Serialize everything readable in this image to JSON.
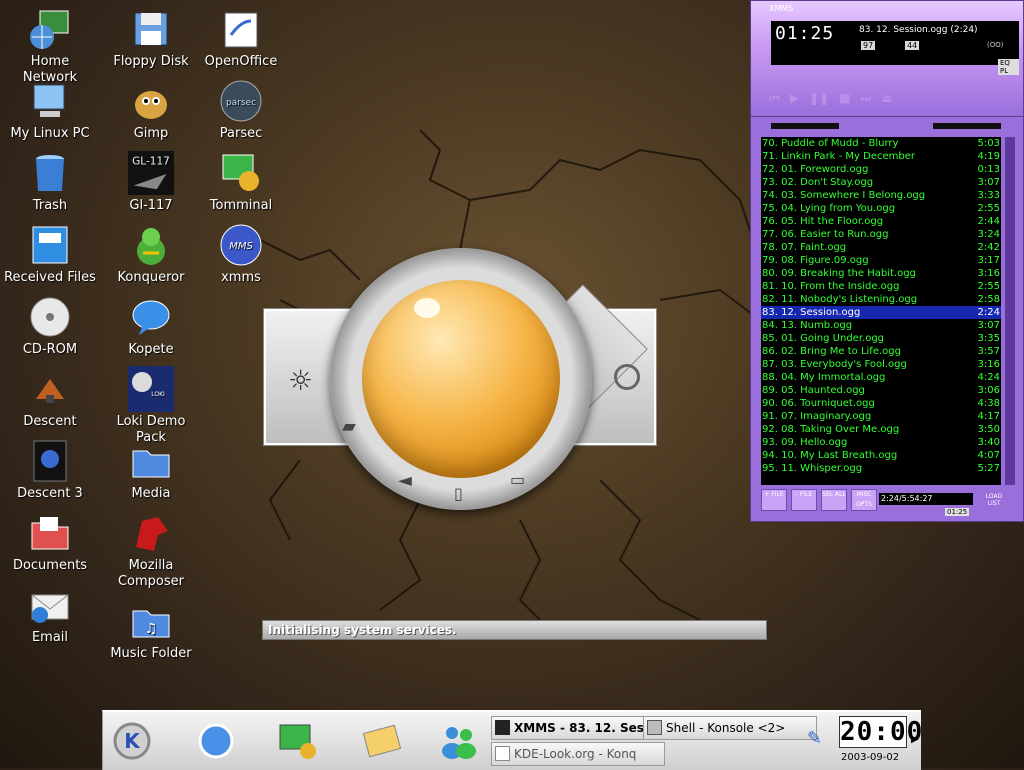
{
  "desktop": {
    "icons": [
      {
        "label": "Home Network"
      },
      {
        "label": "Floppy Disk"
      },
      {
        "label": "OpenOffice"
      },
      {
        "label": "My Linux PC"
      },
      {
        "label": "Gimp"
      },
      {
        "label": "Parsec"
      },
      {
        "label": "Trash"
      },
      {
        "label": "Gl-117"
      },
      {
        "label": "Tomminal"
      },
      {
        "label": "Received Files"
      },
      {
        "label": "Konqueror"
      },
      {
        "label": "xmms"
      },
      {
        "label": "CD-ROM"
      },
      {
        "label": "Kopete"
      },
      {
        "label": "Descent"
      },
      {
        "label": "Loki Demo Pack"
      },
      {
        "label": "Descent 3"
      },
      {
        "label": "Media"
      },
      {
        "label": "Documents"
      },
      {
        "label": "Mozilla Composer"
      },
      {
        "label": "Email"
      },
      {
        "label": "Music Folder"
      }
    ]
  },
  "splash": {
    "status_text": "Initialising system services."
  },
  "xmms": {
    "title": "XMMS",
    "time": "01:25",
    "song_title": "83. 12. Session.ogg (2:24)",
    "kbps": "97",
    "khz": "44",
    "channel": "(OO)",
    "mode_label": "EQ PL",
    "playlist": [
      {
        "title": "70. Puddle of Mudd - Blurry",
        "time": "5:03"
      },
      {
        "title": "71. Linkin Park - My December",
        "time": "4:19"
      },
      {
        "title": "72. 01. Foreword.ogg",
        "time": "0:13"
      },
      {
        "title": "73. 02. Don't Stay.ogg",
        "time": "3:07"
      },
      {
        "title": "74. 03. Somewhere I Belong.ogg",
        "time": "3:33"
      },
      {
        "title": "75. 04. Lying from You.ogg",
        "time": "2:55"
      },
      {
        "title": "76. 05. Hit the Floor.ogg",
        "time": "2:44"
      },
      {
        "title": "77. 06. Easier to Run.ogg",
        "time": "3:24"
      },
      {
        "title": "78. 07. Faint.ogg",
        "time": "2:42"
      },
      {
        "title": "79. 08. Figure.09.ogg",
        "time": "3:17"
      },
      {
        "title": "80. 09. Breaking the Habit.ogg",
        "time": "3:16"
      },
      {
        "title": "81. 10. From the Inside.ogg",
        "time": "2:55"
      },
      {
        "title": "82. 11. Nobody's Listening.ogg",
        "time": "2:58"
      },
      {
        "title": "83. 12. Session.ogg",
        "time": "2:24",
        "selected": true
      },
      {
        "title": "84. 13. Numb.ogg",
        "time": "3:07"
      },
      {
        "title": "85. 01. Going Under.ogg",
        "time": "3:35"
      },
      {
        "title": "86. 02. Bring Me to Life.ogg",
        "time": "3:57"
      },
      {
        "title": "87. 03. Everybody's Fool.ogg",
        "time": "3:16"
      },
      {
        "title": "88. 04. My Immortal.ogg",
        "time": "4:24"
      },
      {
        "title": "89. 05. Haunted.ogg",
        "time": "3:06"
      },
      {
        "title": "90. 06. Tourniquet.ogg",
        "time": "4:38"
      },
      {
        "title": "91. 07. Imaginary.ogg",
        "time": "4:17"
      },
      {
        "title": "92. 08. Taking Over Me.ogg",
        "time": "3:50"
      },
      {
        "title": "93. 09. Hello.ogg",
        "time": "3:40"
      },
      {
        "title": "94. 10. My Last Breath.ogg",
        "time": "4:07"
      },
      {
        "title": "95. 11. Whisper.ogg",
        "time": "5:27"
      }
    ],
    "pl_buttons": [
      "+ FILE",
      "- FILE",
      "SEL ALL",
      "MISC OPTS"
    ],
    "pl_total": "2:24/5:54:27",
    "pl_time": "01:25",
    "pl_load": "LOAD LIST"
  },
  "taskbar": {
    "tasks": [
      {
        "label": "XMMS - 83. 12. Session"
      },
      {
        "label": "Shell - Konsole <2>"
      },
      {
        "label": "KDE-Look.org - Konq"
      }
    ],
    "clock": "20:00",
    "date": "2003-09-02"
  }
}
